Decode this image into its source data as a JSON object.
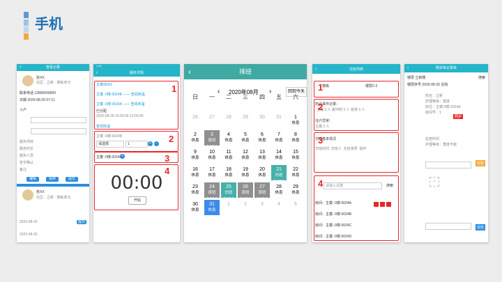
{
  "page": {
    "title": "手机",
    "accent": "#1f6fb3"
  },
  "screen1": {
    "header": "查看记录",
    "name": "张XX",
    "info": "社区：立新 · 楼栋单元",
    "phone_label": "联系电话",
    "phone": "13800000000",
    "date_label": "日期",
    "date": "2020-08-20 07:11",
    "type_label": "入户",
    "fields": [
      "服务项目",
      "服务时长",
      "服务人员",
      "签字确认",
      "备注"
    ],
    "btn_a": "编辑",
    "btn_b": "保存",
    "btn_c": "提交",
    "date2": "2020-08-20",
    "date3": "2020-08-20"
  },
  "screen2": {
    "header": "服务详情",
    "time": "1:44",
    "line1": "主模块001",
    "line2": "主模 -0楼-0024B —— 查阅床温",
    "line3": "主模 -0楼-0024A —— 查阅床温",
    "line4": "已分配",
    "line5": "2020-08-28 16:00:00-12:00:00",
    "section": "查阅床温",
    "unit": "主模 -0楼-0024B",
    "select": "请选择",
    "qty": "1",
    "item": "主模 -0楼-0024C",
    "timer": "00:00",
    "start": "开始"
  },
  "calendar": {
    "header": "排班",
    "month": "2020年08月",
    "today_button": "回到今天",
    "weekdays": [
      "日",
      "一",
      "二",
      "三",
      "四",
      "五",
      "六"
    ],
    "cells": [
      {
        "d": "26",
        "s": "",
        "t": "grey"
      },
      {
        "d": "27",
        "s": "",
        "t": "grey"
      },
      {
        "d": "28",
        "s": "",
        "t": "grey"
      },
      {
        "d": "29",
        "s": "",
        "t": "grey"
      },
      {
        "d": "30",
        "s": "",
        "t": "grey"
      },
      {
        "d": "31",
        "s": "",
        "t": "grey"
      },
      {
        "d": "1",
        "s": "休息",
        "t": ""
      },
      {
        "d": "2",
        "s": "休息",
        "t": ""
      },
      {
        "d": "3",
        "s": "夜班",
        "s2": "8.17.1",
        "t": "dark"
      },
      {
        "d": "4",
        "s": "休息",
        "t": ""
      },
      {
        "d": "5",
        "s": "休息",
        "t": ""
      },
      {
        "d": "6",
        "s": "休息",
        "t": ""
      },
      {
        "d": "7",
        "s": "休息",
        "t": ""
      },
      {
        "d": "8",
        "s": "休息",
        "t": ""
      },
      {
        "d": "9",
        "s": "休息",
        "t": ""
      },
      {
        "d": "10",
        "s": "休息",
        "t": ""
      },
      {
        "d": "11",
        "s": "休息",
        "t": ""
      },
      {
        "d": "12",
        "s": "休息",
        "t": ""
      },
      {
        "d": "13",
        "s": "休息",
        "t": ""
      },
      {
        "d": "14",
        "s": "休息",
        "t": ""
      },
      {
        "d": "15",
        "s": "休息",
        "t": ""
      },
      {
        "d": "16",
        "s": "休息",
        "t": ""
      },
      {
        "d": "17",
        "s": "休息",
        "t": ""
      },
      {
        "d": "18",
        "s": "休息",
        "t": ""
      },
      {
        "d": "19",
        "s": "休息",
        "t": ""
      },
      {
        "d": "20",
        "s": "休息",
        "t": ""
      },
      {
        "d": "21",
        "s": "白班",
        "s2": "8.17.1",
        "t": "teal"
      },
      {
        "d": "22",
        "s": "休息",
        "t": ""
      },
      {
        "d": "23",
        "s": "休息",
        "t": ""
      },
      {
        "d": "24",
        "s": "夜班",
        "s2": "8.17.1",
        "t": "dark"
      },
      {
        "d": "25",
        "s": "白班",
        "s2": "8.17.1",
        "t": "teal"
      },
      {
        "d": "26",
        "s": "夜班",
        "s2": "8.17.1",
        "t": "dark"
      },
      {
        "d": "27",
        "s": "夜班",
        "s2": "8.17.1",
        "t": "dark"
      },
      {
        "d": "28",
        "s": "休息",
        "t": ""
      },
      {
        "d": "29",
        "s": "休息",
        "t": ""
      },
      {
        "d": "30",
        "s": "休息",
        "t": ""
      },
      {
        "d": "31",
        "s": "休息",
        "t": "blue"
      },
      {
        "d": "1",
        "s": "",
        "t": "grey"
      },
      {
        "d": "2",
        "s": "",
        "t": "grey"
      },
      {
        "d": "3",
        "s": "",
        "t": "grey"
      },
      {
        "d": "4",
        "s": "",
        "t": "grey"
      },
      {
        "d": "5",
        "s": "",
        "t": "grey"
      }
    ]
  },
  "screen4": {
    "header": "交班列表",
    "f1": "楼栋",
    "f2": "楼层2-2",
    "sec1": "药品事件记录：",
    "sec1_vals": [
      "主模 3 人",
      "缓冲药 3 人",
      "普通 3 人"
    ],
    "sec2": "住户异常：",
    "sec2_val": "主模 3 人",
    "sec3": "交班基本情况",
    "table_headers": [
      "交班时间",
      "交班人",
      "交班事项",
      "操作"
    ],
    "search_placeholder": "请输入关键",
    "search_btn": "搜索",
    "entries": [
      "房间：主模 -0楼-0024A",
      "房间：主模 -0楼-0024B",
      "房间：主模 -0楼-0024C",
      "房间：主模 -0楼-0024D"
    ]
  },
  "screen5": {
    "header": "照护单记录单",
    "filter1": "楼层",
    "filter2": "立新楼",
    "filter3": "楼层序号",
    "filter4": "2020-08-25",
    "filter5": "在院",
    "search": "搜索",
    "rows": [
      "姓名：立新",
      "护理等级：重度",
      "床位：主模-0楼-0024A",
      "房间号：1",
      "巡查时间",
      "护理等级：重度不能"
    ],
    "badge": "照护",
    "side_btn": "巡检"
  },
  "numbers": [
    "1",
    "2",
    "3",
    "4"
  ]
}
